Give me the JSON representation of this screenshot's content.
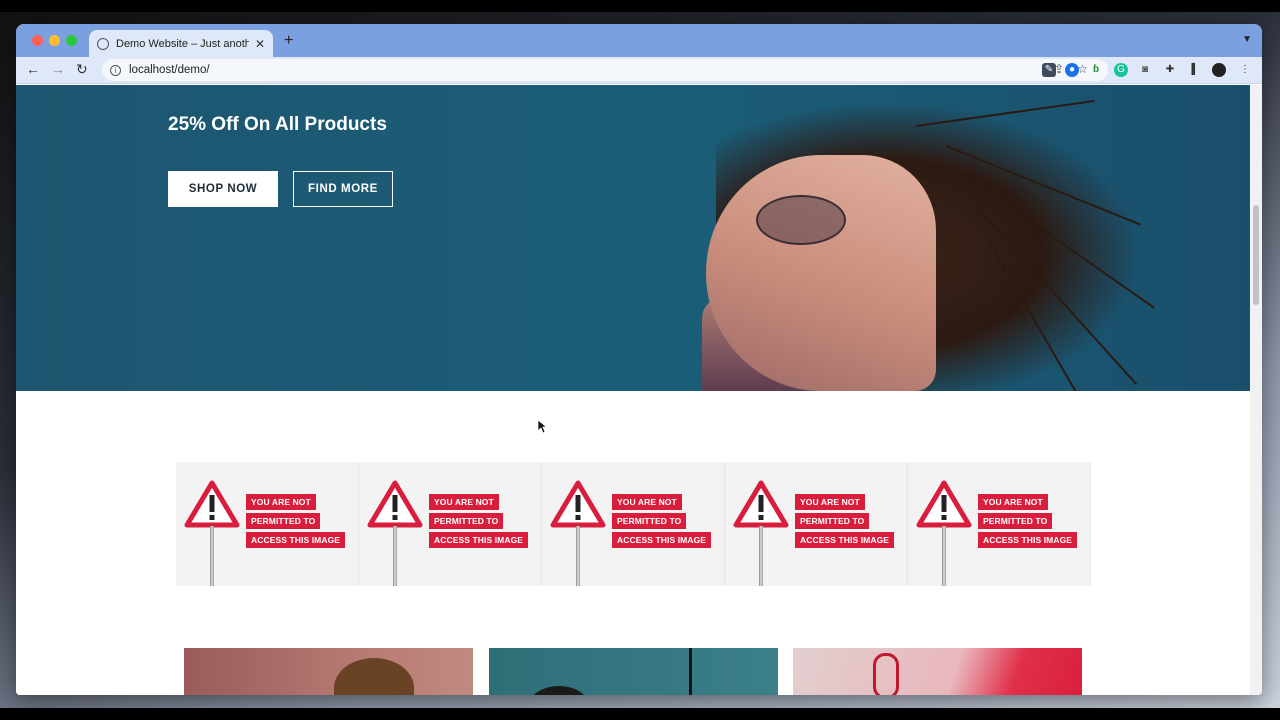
{
  "browser": {
    "tab_title": "Demo Website – Just another W",
    "url": "localhost/demo/",
    "new_tab_symbol": "+",
    "tab_close_symbol": "✕"
  },
  "hero": {
    "headline": "25% Off On All Products",
    "shop_now_label": "SHOP NOW",
    "find_more_label": "FIND MORE"
  },
  "restricted_image": {
    "line1": "YOU ARE NOT",
    "line2": "PERMITTED TO",
    "line3": "ACCESS THIS IMAGE",
    "count": 5
  },
  "colors": {
    "hero_bg": "#1b5e78",
    "badge_red": "#d81e3c",
    "chrome_tab_strip": "#7aa0e0",
    "chrome_toolbar": "#dfe8f8"
  },
  "icons": {
    "back": "arrow-left-icon",
    "forward": "arrow-right-icon",
    "reload": "reload-icon",
    "info": "info-icon",
    "share": "share-icon",
    "bookmark": "star-icon",
    "extensions": "puzzle-icon",
    "sidebar": "sidebar-icon",
    "menu": "kebab-menu-icon",
    "warning": "warning-triangle-icon"
  }
}
